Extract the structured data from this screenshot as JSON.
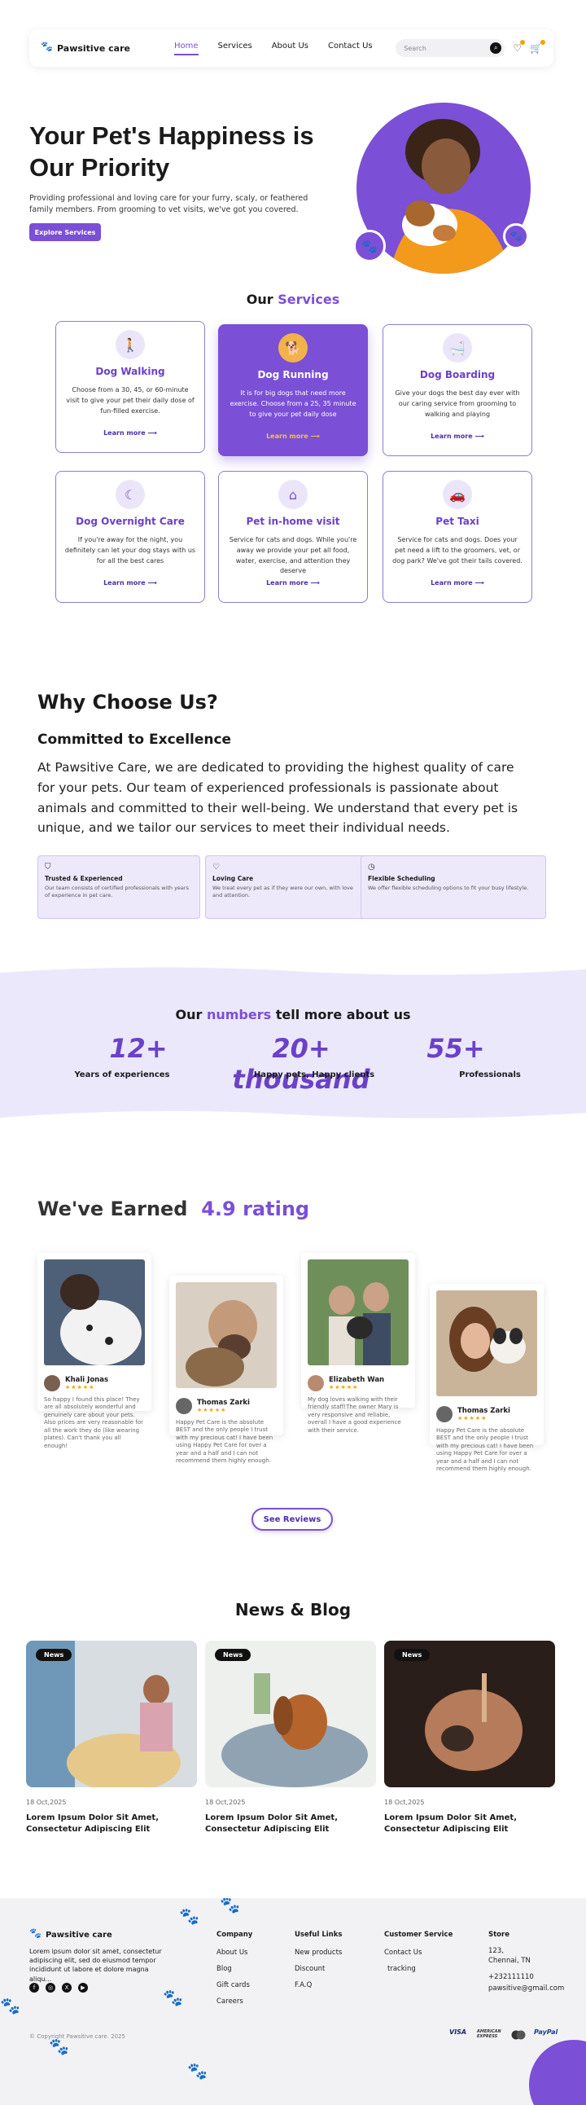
{
  "nav": {
    "brand": "Pawsitive care",
    "links": [
      "Home",
      "Services",
      "About Us",
      "Contact Us"
    ],
    "search_placeholder": "Search"
  },
  "hero": {
    "title": "Your Pet's Happiness is Our Priority",
    "subtitle": "Providing professional and loving care for your furry, scaly, or feathered family members. From grooming to vet visits, we've got you covered.",
    "cta": "Explore Services"
  },
  "services": {
    "title_prefix": "Our",
    "title_accent": "Services",
    "link_label": "Learn more",
    "items": [
      {
        "title": "Dog Walking",
        "desc": "Choose from a 30, 45, or 60-minute visit to give your pet their daily dose of fun-filled exercise.",
        "icon": "walk-icon"
      },
      {
        "title": "Dog Running",
        "desc": "It is for big dogs that need more exercise. Choose from a 25, 35 minute to give your pet daily dose",
        "icon": "dog-icon"
      },
      {
        "title": "Dog Boarding",
        "desc": "Give your dogs the best day ever with our caring service from grooming to walking and playing",
        "icon": "boarding-icon"
      },
      {
        "title": "Dog Overnight Care",
        "desc": "If you're away for the night, you definitely can let your dog stays with us for all the best cares",
        "icon": "moon-icon"
      },
      {
        "title": "Pet in-home visit",
        "desc": "Service for cats and dogs. While you're away we provide your pet all food, water, exercise, and attention they deserve",
        "icon": "home-icon"
      },
      {
        "title": "Pet Taxi",
        "desc": "Service for cats and dogs. Does your pet need a lift to the groomers, vet, or dog park? We've got their tails covered.",
        "icon": "car-icon"
      }
    ]
  },
  "why": {
    "title": "Why Choose Us?",
    "subtitle": "Committed to Excellence",
    "text": "At Pawsitive Care, we are dedicated to providing the highest quality of care for your pets. Our team of experienced professionals is passionate about animals and committed to their well-being. We understand that every pet is unique, and we tailor our services to meet their individual needs.",
    "features": [
      {
        "title": "Trusted & Experienced",
        "text": "Our team consists of certified professionals with years of experience in pet care.",
        "icon": "shield-icon"
      },
      {
        "title": "Loving Care",
        "text": "We treat every pet as if they were our own, with love and attention.",
        "icon": "heart-icon"
      },
      {
        "title": "Flexible Scheduling",
        "text": "We offer flexible scheduling options to fit your busy lifestyle.",
        "icon": "clock-icon"
      }
    ]
  },
  "stats": {
    "title_prefix": "Our",
    "title_accent": "numbers",
    "title_suffix": "tell more about us",
    "items": [
      {
        "value": "12+",
        "label": "Years of experiences"
      },
      {
        "value": "20+ thousand",
        "label": "Happy pets, Happy clients"
      },
      {
        "value": "55+",
        "label": "Professionals"
      }
    ]
  },
  "reviews": {
    "title_prefix": "We've Earned",
    "title_accent": "4.9 rating",
    "see_more": "See Reviews",
    "items": [
      {
        "name": "Khali Jonas",
        "stars": "★★★★★",
        "text": "So happy I found this place! They are all absolutely wonderful and genuinely care about your pets. Also prices are very reasonable for all the work they do (like wearing plates). Can't thank you all enough!"
      },
      {
        "name": "Thomas Zarki",
        "stars": "★★★★★",
        "text": "Happy Pet Care is the absolute BEST and the only people I trust with my precious cat! I have been using Happy Pet Care for over a year and a half and I can not recommend them highly enough."
      },
      {
        "name": "Elizabeth Wan",
        "stars": "★★★★★",
        "text": "My dog loves walking with their friendly staff!The owner Mary is very responsive and reliable, overall I have a good experience with their service."
      },
      {
        "name": "Thomas Zarki",
        "stars": "★★★★★",
        "text": "Happy Pet Care is the absolute BEST and the only people I trust with my precious cat! I have been using Happy Pet Care for over a year and a half and I can not recommend them highly enough."
      }
    ]
  },
  "news": {
    "title": "News & Blog",
    "badge": "News",
    "items": [
      {
        "date": "18 Oct,2025",
        "headline": "Lorem Ipsum Dolor Sit Amet, Consectetur Adipiscing Elit"
      },
      {
        "date": "18 Oct,2025",
        "headline": "Lorem Ipsum Dolor Sit Amet, Consectetur Adipiscing Elit"
      },
      {
        "date": "18 Oct,2025",
        "headline": "Lorem Ipsum Dolor Sit Amet, Consectetur Adipiscing Elit"
      }
    ]
  },
  "footer": {
    "brand": "Pawsitive care",
    "about": "Lorem ipsum dolor sit amet, consectetur adipiscing elit, sed do eiusmod tempor incididunt ut labore et dolore magna aliqu...",
    "company_title": "Company",
    "company": [
      "About Us",
      "Blog",
      "Gift cards",
      "Careers"
    ],
    "useful_title": "Useful Links",
    "useful": [
      "New products",
      "Discount",
      "F.A.Q"
    ],
    "customer_title": "Customer Service",
    "customer": [
      "Contact Us",
      "tracking"
    ],
    "store_title": "Store",
    "store_address_1": "123,",
    "store_address_2": "Chennai, TN",
    "store_phone": "+232111110",
    "store_email": "pawsitive@gmail.com",
    "copyright": "© Copyright Pawsitive care. 2025",
    "payments": [
      "VISA",
      "AMERICAN EXPRESS",
      "mastercard",
      "PayPal"
    ]
  },
  "colors": {
    "accent": "#7b4fd6",
    "accent_light": "#ece8fb",
    "star": "#f7a100"
  }
}
